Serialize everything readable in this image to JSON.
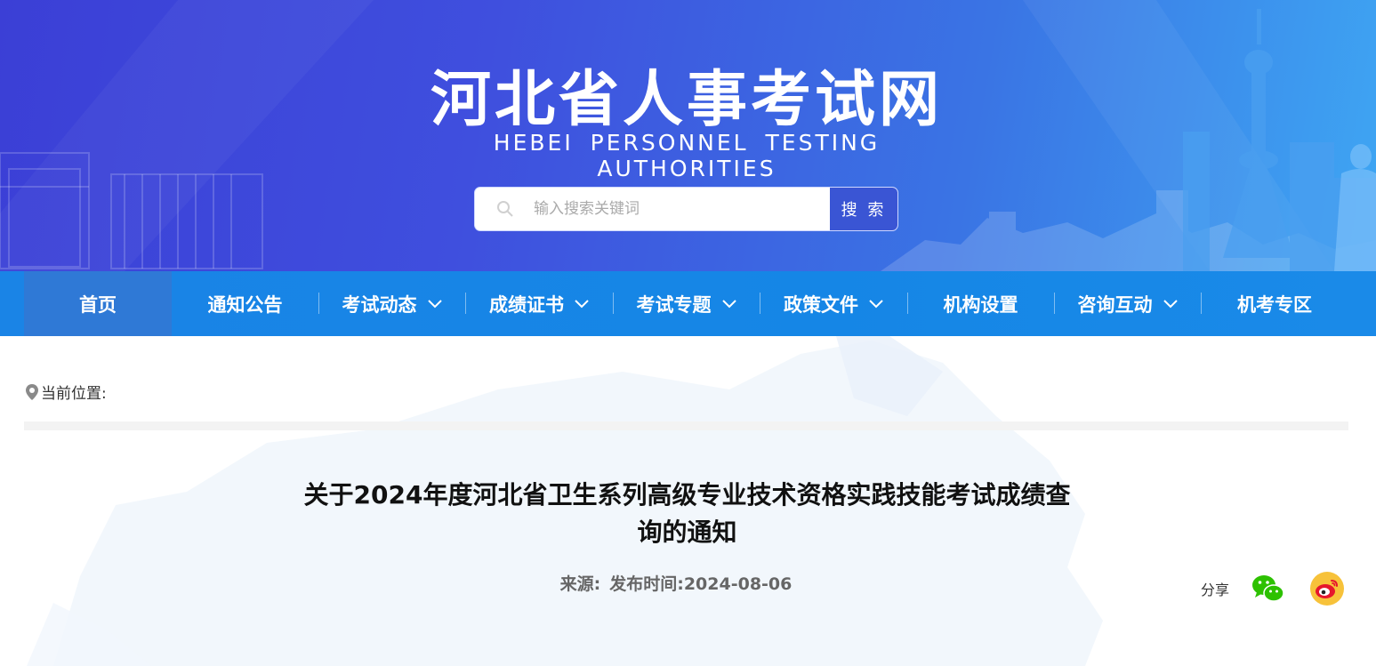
{
  "header": {
    "title": "河北省人事考试网",
    "subtitle": "HEBEI PERSONNEL TESTING AUTHORITIES",
    "search": {
      "placeholder": "输入搜索关键词",
      "button_label": "搜 索"
    }
  },
  "nav": {
    "items": [
      {
        "label": "首页",
        "has_dropdown": false,
        "active": true
      },
      {
        "label": "通知公告",
        "has_dropdown": false
      },
      {
        "label": "考试动态",
        "has_dropdown": true
      },
      {
        "label": "成绩证书",
        "has_dropdown": true
      },
      {
        "label": "考试专题",
        "has_dropdown": true
      },
      {
        "label": "政策文件",
        "has_dropdown": true
      },
      {
        "label": "机构设置",
        "has_dropdown": false
      },
      {
        "label": "咨询互动",
        "has_dropdown": true
      },
      {
        "label": "机考专区",
        "has_dropdown": false
      }
    ]
  },
  "breadcrumb": {
    "label": "当前位置:"
  },
  "article": {
    "title_line1": "关于2024年度河北省卫生系列高级专业技术资格实践技能考试成绩查",
    "title_line2": "询的通知",
    "source_label": "来源:",
    "date_label": "发布时间:2024-08-06"
  },
  "share": {
    "label": "分享",
    "icons": [
      "wechat-icon",
      "weibo-icon"
    ]
  },
  "colors": {
    "banner_start": "#3b3fd6",
    "banner_end": "#3ea6f3",
    "nav_bg": "#1586e6",
    "nav_active": "#2f79d6",
    "search_button": "#3a55d4",
    "wechat_green": "#2dc100",
    "weibo_yellow": "#f7c23a",
    "weibo_red": "#e6162d"
  }
}
